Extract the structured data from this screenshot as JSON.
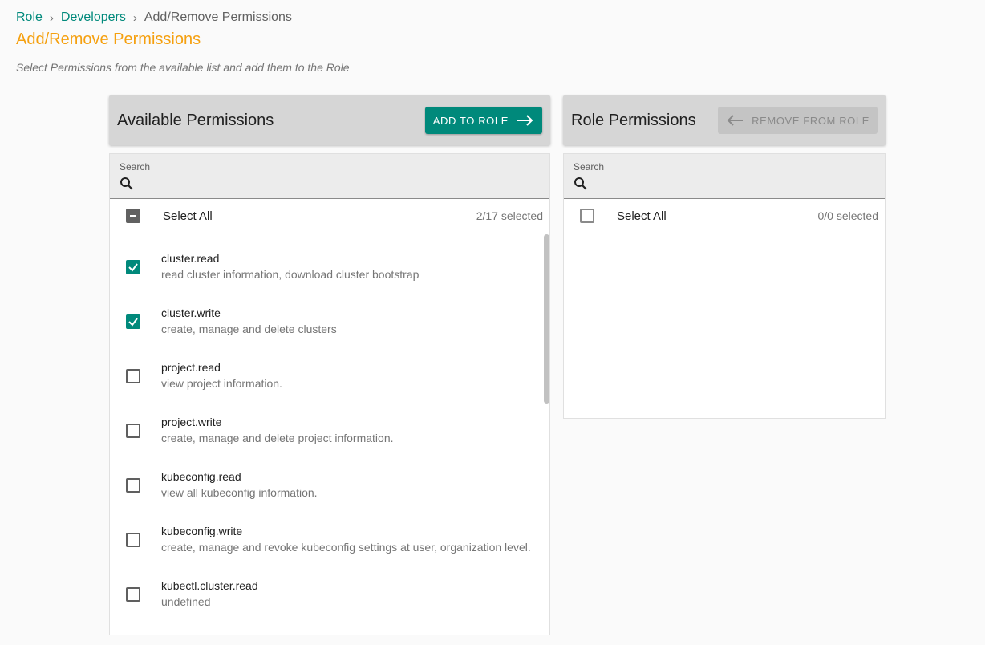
{
  "breadcrumb": {
    "items": [
      "Role",
      "Developers"
    ],
    "current": "Add/Remove Permissions",
    "separator": "›"
  },
  "page": {
    "title": "Add/Remove Permissions",
    "subtitle": "Select Permissions from the available list and add them to the Role"
  },
  "available": {
    "title": "Available Permissions",
    "add_button_label": "ADD TO ROLE",
    "search_label": "Search",
    "search_value": "",
    "select_all_label": "Select All",
    "selected_count": "2/17 selected",
    "items": [
      {
        "name": "cluster.read",
        "description": "read cluster information, download cluster bootstrap",
        "checked": true
      },
      {
        "name": "cluster.write",
        "description": "create, manage and delete clusters",
        "checked": true
      },
      {
        "name": "project.read",
        "description": "view project information.",
        "checked": false
      },
      {
        "name": "project.write",
        "description": "create, manage and delete project information.",
        "checked": false
      },
      {
        "name": "kubeconfig.read",
        "description": "view all kubeconfig information.",
        "checked": false
      },
      {
        "name": "kubeconfig.write",
        "description": "create, manage and revoke kubeconfig settings at user, organization level.",
        "checked": false
      },
      {
        "name": "kubectl.cluster.read",
        "description": "undefined",
        "checked": false
      }
    ]
  },
  "role": {
    "title": "Role Permissions",
    "remove_button_label": "REMOVE FROM ROLE",
    "search_label": "Search",
    "search_value": "",
    "select_all_label": "Select All",
    "selected_count": "0/0 selected"
  },
  "colors": {
    "accent": "#00897b",
    "title": "#f5a00f",
    "header_bg": "#d6d6d6"
  }
}
